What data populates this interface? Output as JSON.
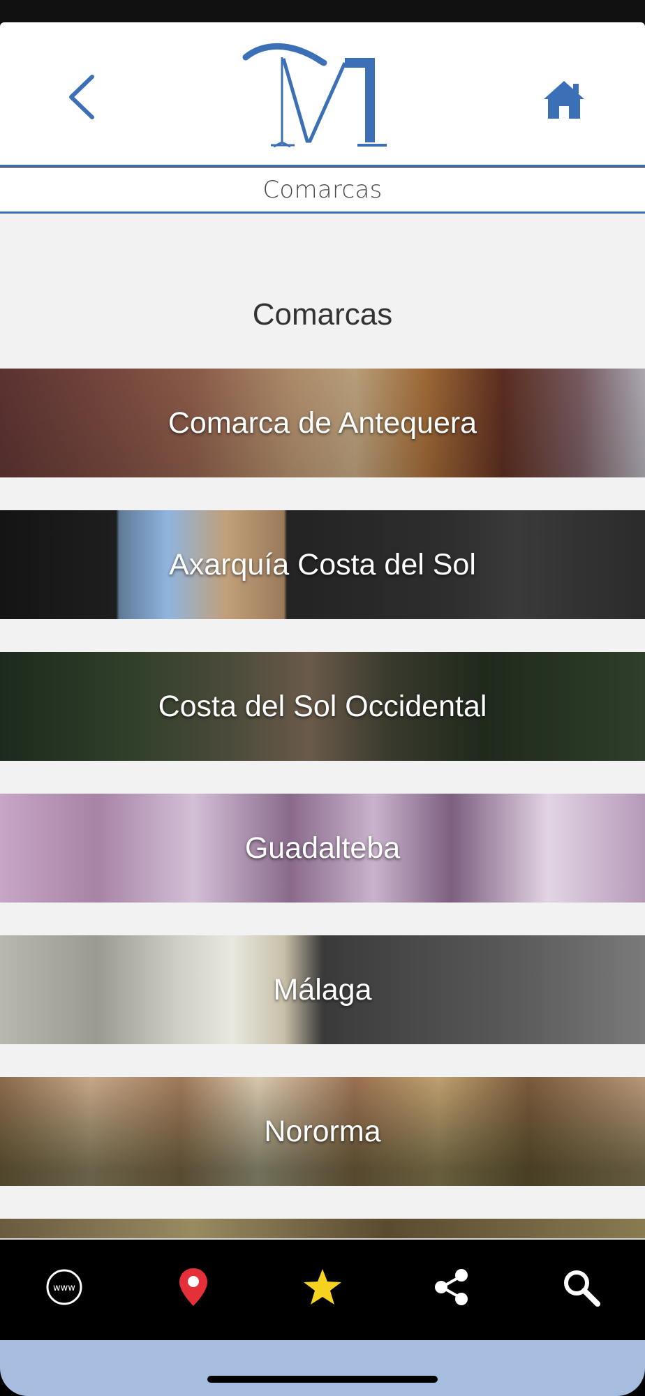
{
  "header": {
    "back_icon": "chevron-left-icon",
    "home_icon": "home-icon",
    "logo_text": "M",
    "accent_color": "#3b6fb6"
  },
  "subtitle": "Comarcas",
  "section": {
    "title": "Comarcas"
  },
  "regions": [
    {
      "label": "Comarca de Antequera"
    },
    {
      "label": "Axarquía Costa del Sol"
    },
    {
      "label": "Costa del Sol Occidental"
    },
    {
      "label": "Guadalteba"
    },
    {
      "label": "Málaga"
    },
    {
      "label": "Nororma"
    },
    {
      "label": ""
    }
  ],
  "tab_bar": {
    "items": [
      {
        "icon": "www-icon",
        "text": "www"
      },
      {
        "icon": "map-pin-icon",
        "color": "#e5303a"
      },
      {
        "icon": "star-icon",
        "color": "#f4d21f"
      },
      {
        "icon": "share-icon"
      },
      {
        "icon": "search-icon"
      }
    ]
  }
}
